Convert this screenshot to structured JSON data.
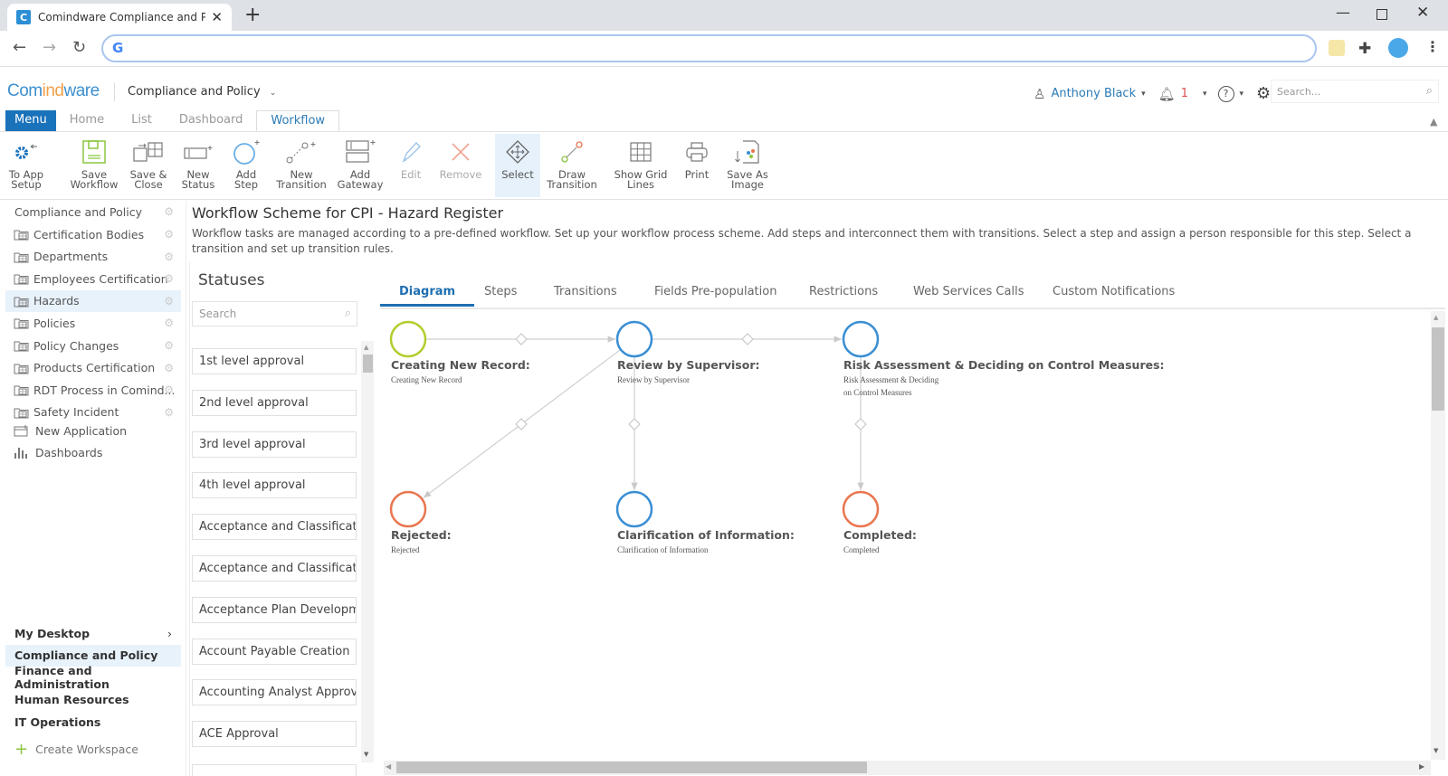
{
  "browser": {
    "tab_title": "Comindware Compliance and Po",
    "tab_favicon_letter": "C",
    "address": ""
  },
  "header": {
    "logo_parts": [
      "Com",
      "ind",
      "ware"
    ],
    "workspace": "Compliance and Policy",
    "user": "Anthony Black",
    "notifications_count": "1",
    "search_placeholder": "Search..."
  },
  "app_tabs": [
    {
      "label": "Menu"
    },
    {
      "label": "Home"
    },
    {
      "label": "List"
    },
    {
      "label": "Dashboard"
    },
    {
      "label": "Workflow",
      "active": true
    }
  ],
  "ribbon": [
    {
      "line1": "To App",
      "line2": "Setup",
      "icon": "gear-back-icon"
    },
    {
      "line1": "Save",
      "line2": "Workflow",
      "icon": "save-icon"
    },
    {
      "line1": "Save &",
      "line2": "Close",
      "icon": "save-close-icon"
    },
    {
      "line1": "New",
      "line2": "Status",
      "icon": "new-status-icon"
    },
    {
      "line1": "Add",
      "line2": "Step",
      "icon": "add-step-icon"
    },
    {
      "line1": "New",
      "line2": "Transition",
      "icon": "new-transition-icon"
    },
    {
      "line1": "Add",
      "line2": "Gateway",
      "icon": "add-gateway-icon"
    },
    {
      "line1": "Edit",
      "line2": "",
      "icon": "pencil-icon",
      "disabled": true
    },
    {
      "line1": "Remove",
      "line2": "",
      "icon": "remove-icon",
      "disabled": true
    },
    {
      "line1": "Select",
      "line2": "",
      "icon": "select-move-icon",
      "selected": true
    },
    {
      "line1": "Draw",
      "line2": "Transition",
      "icon": "draw-transition-icon"
    },
    {
      "line1": "Show Grid",
      "line2": "Lines",
      "icon": "grid-icon"
    },
    {
      "line1": "Print",
      "line2": "",
      "icon": "printer-icon"
    },
    {
      "line1": "Save As",
      "line2": "Image",
      "icon": "save-image-icon"
    }
  ],
  "sidebar": {
    "section": "Compliance and Policy",
    "items": [
      {
        "label": "Certification Bodies"
      },
      {
        "label": "Departments"
      },
      {
        "label": "Employees Certification"
      },
      {
        "label": "Hazards",
        "active": true
      },
      {
        "label": "Policies"
      },
      {
        "label": "Policy Changes"
      },
      {
        "label": "Products Certification"
      },
      {
        "label": "RDT Process in Comind..."
      },
      {
        "label": "Safety Incident"
      }
    ],
    "new_application": "New Application",
    "dashboards": "Dashboards",
    "workspaces": [
      {
        "label": "My Desktop",
        "chevron": "›"
      },
      {
        "label": "Compliance and Policy",
        "active": true
      },
      {
        "label": "Finance and Administration"
      },
      {
        "label": "Human Resources"
      },
      {
        "label": "IT Operations"
      }
    ],
    "create_workspace": "Create Workspace"
  },
  "page": {
    "title": "Workflow Scheme for CPI - Hazard Register",
    "description": "Workflow tasks are managed according to a pre-defined workflow. Set up your workflow process scheme. Add steps and interconnect them with transitions. Select a step and assign a person responsible for this step. Select a transition and set up transition rules."
  },
  "statuses": {
    "heading": "Statuses",
    "search_placeholder": "Search",
    "items": [
      "1st level approval",
      "2nd level approval",
      "3rd level approval",
      "4th level approval",
      "Acceptance and Classificati...",
      "Acceptance and Classificati...",
      "Acceptance Plan Developm...",
      "Account Payable Creation",
      "Accounting Analyst Approval",
      "ACE Approval"
    ]
  },
  "workflow_tabs": [
    {
      "label": "Diagram",
      "active": true
    },
    {
      "label": "Steps"
    },
    {
      "label": "Transitions"
    },
    {
      "label": "Fields Pre-population"
    },
    {
      "label": "Restrictions"
    },
    {
      "label": "Web Services Calls"
    },
    {
      "label": "Custom Notifications"
    }
  ],
  "diagram": {
    "colors": {
      "start": "#b5cc2e",
      "step": "#3a8fd4",
      "end": "#e9764f",
      "line": "#cfcfcf"
    },
    "nodes": [
      {
        "id": "creating",
        "title": "Creating New Record:",
        "sub": [
          "Creating New Record"
        ],
        "kind": "start"
      },
      {
        "id": "review",
        "title": "Review by Supervisor:",
        "sub": [
          "Review by Supervisor"
        ],
        "kind": "step"
      },
      {
        "id": "risk",
        "title": "Risk Assessment & Deciding on Control Measures:",
        "sub": [
          "Risk Assessment & Deciding",
          "on Control Measures"
        ],
        "kind": "step"
      },
      {
        "id": "rejected",
        "title": "Rejected:",
        "sub": [
          "Rejected"
        ],
        "kind": "end"
      },
      {
        "id": "clarification",
        "title": "Clarification of Information:",
        "sub": [
          "Clarification of Information"
        ],
        "kind": "step"
      },
      {
        "id": "completed",
        "title": "Completed:",
        "sub": [
          "Completed"
        ],
        "kind": "end"
      }
    ],
    "transitions": [
      {
        "from": "creating",
        "to": "review"
      },
      {
        "from": "review",
        "to": "risk"
      },
      {
        "from": "review",
        "to": "rejected"
      },
      {
        "from": "review",
        "to": "clarification"
      },
      {
        "from": "risk",
        "to": "completed"
      }
    ]
  }
}
